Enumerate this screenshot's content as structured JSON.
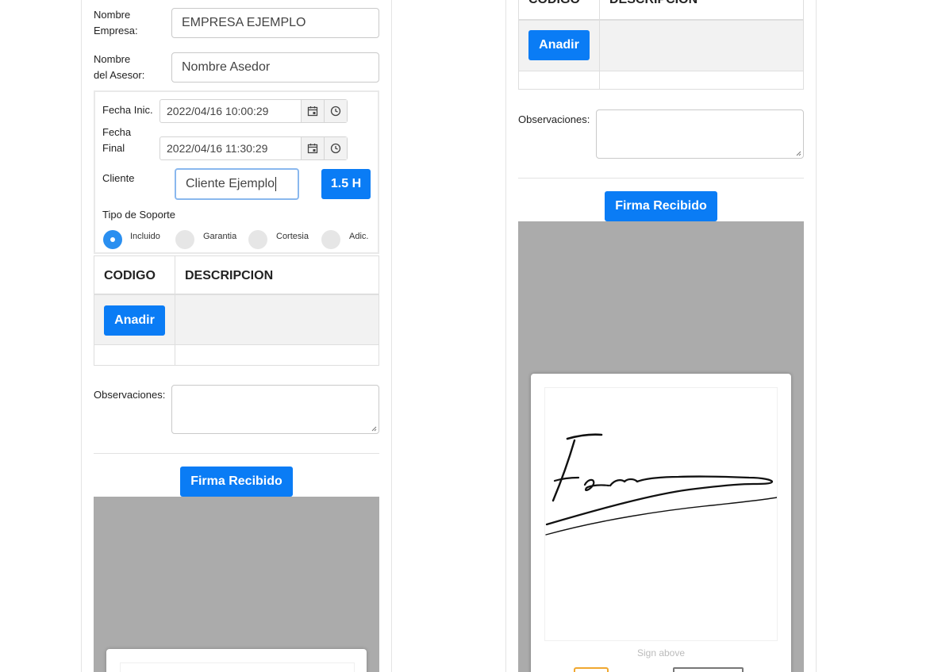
{
  "form": {
    "empresa_label_1": "Nombre",
    "empresa_label_2": "Empresa:",
    "empresa_value": "EMPRESA EJEMPLO",
    "asesor_label_1": "Nombre",
    "asesor_label_2": "del Asesor:",
    "asesor_value": "Nombre Asedor",
    "fecha_inic_label": "Fecha Inic.",
    "fecha_inic_value": "2022/04/16 10:00:29",
    "fecha_final_label_1": "Fecha",
    "fecha_final_label_2": "Final",
    "fecha_final_value": "2022/04/16 11:30:29",
    "cliente_label": "Cliente",
    "cliente_value": "Cliente Ejemplo",
    "hours_badge": "1.5 H",
    "tipo_soporte_label": "Tipo de Soporte",
    "tipo_options": [
      "Incluido",
      "Garantia",
      "Cortesia",
      "Adic."
    ],
    "tipo_selected": "Incluido"
  },
  "table": {
    "headers": [
      "CODIGO",
      "DESCRIPCION"
    ],
    "add_button": "Anadir"
  },
  "observaciones_label": "Observaciones:",
  "firma_button": "Firma Recibido",
  "signature": {
    "hint": "Sign above"
  },
  "colors": {
    "primary": "#0a7cf5",
    "radio_selected": "#2a8ff0",
    "signature_bg": "#ababab"
  }
}
